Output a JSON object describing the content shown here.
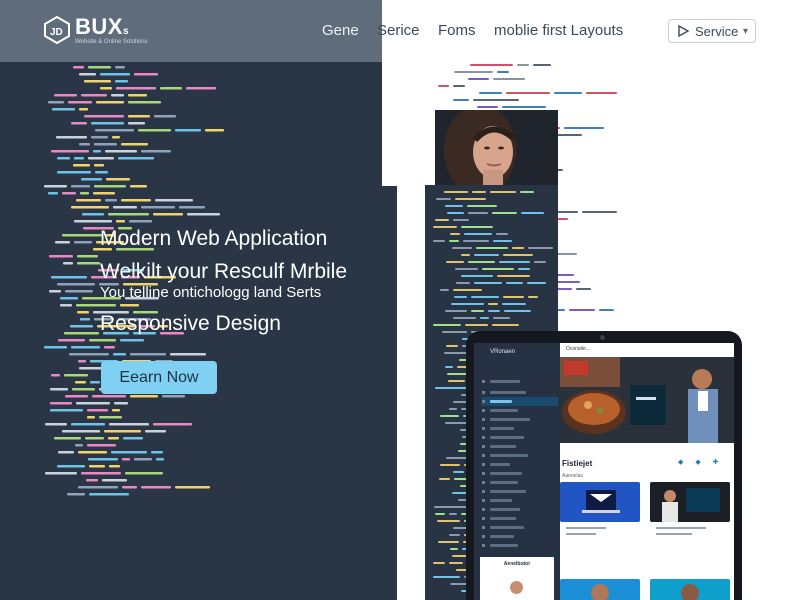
{
  "header": {
    "logo_text": "BUX",
    "logo_sub": "s",
    "logo_tagline": "Website & Online Solutions",
    "nav": [
      "Gene",
      "Serice",
      "Foms",
      "moblie first Layouts"
    ],
    "service_button": {
      "label": "Service",
      "icon": "play-icon",
      "chevron": "chevron-down-icon"
    }
  },
  "hero": {
    "line1": "Modern Web Application",
    "line2": "Welkilt your Resculf Mrbile",
    "line3": "You telline ontichologg land Serts",
    "line4": "Responsive Design",
    "cta_label": "Eearn Now"
  },
  "tablet": {
    "sidebar_title": "VRonaen",
    "topbar_text": "Oconstle...",
    "section_title": "Fistiejet",
    "section_sub": "Aaenelas",
    "footer_title": "Aenelbutor",
    "section_icons": "◆ ◆ ✚"
  },
  "colors": {
    "hero_bg": "#2a3546",
    "header_left": "#5f6c7b",
    "cta": "#7fd0f2",
    "accent": "#1d7fb8"
  }
}
